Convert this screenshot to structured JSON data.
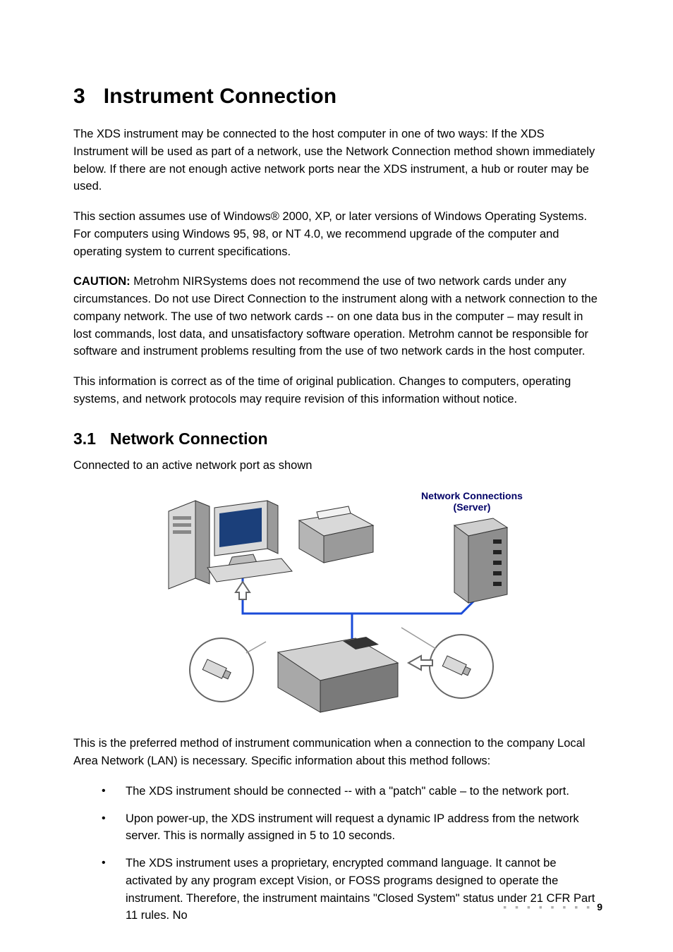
{
  "chapter": {
    "number": "3",
    "title": "Instrument Connection"
  },
  "paragraphs": {
    "p1": "The XDS instrument may be connected to the host computer in one of two ways: If the XDS Instrument will be used as part of a network, use the Network Connection method shown immediately below. If there are not enough active network ports near the XDS instrument, a hub or router may be used.",
    "p2": "This section assumes use of Windows® 2000, XP, or later versions of Windows Operating Systems. For computers using Windows 95, 98, or NT 4.0, we recommend upgrade of the computer and operating system to current specifications.",
    "p3_caution_label": "CAUTION:",
    "p3_rest": " Metrohm NIRSystems does not recommend the use of two network cards under any circumstances. Do not use Direct Connection to the instrument along with a network connection to the company network. The use of two network cards -- on one data bus in the computer – may result in lost commands, lost data, and unsatisfactory software operation. Metrohm cannot be responsible for software and instrument problems resulting from the use of two network cards in the host computer.",
    "p4": "This information is correct as of the time of original publication. Changes to computers, operating systems, and network protocols may require revision of this information without notice.",
    "p5_after_fig": "This is the preferred method of instrument communication when a connection to the company Local Area Network (LAN) is necessary. Specific information about this method follows:"
  },
  "section": {
    "number": "3.1",
    "title": "Network Connection",
    "intro": "Connected to an active network port as shown"
  },
  "figure": {
    "caption_line1": "Network Connections",
    "caption_line2": "(Server)"
  },
  "bullets": [
    "The XDS instrument should be connected -- with a \"patch\" cable – to the network port.",
    "Upon power-up, the XDS instrument will request a dynamic IP address from the network server. This is normally assigned in 5 to 10 seconds.",
    "The XDS instrument uses a proprietary, encrypted command language. It cannot be activated by any program except Vision, or FOSS programs designed to operate the instrument. Therefore, the instrument maintains \"Closed System\" status under 21 CFR Part 11 rules. No"
  ],
  "footer": {
    "dots": "▪ ▪ ▪ ▪ ▪ ▪ ▪ ▪",
    "page_number": "9"
  }
}
